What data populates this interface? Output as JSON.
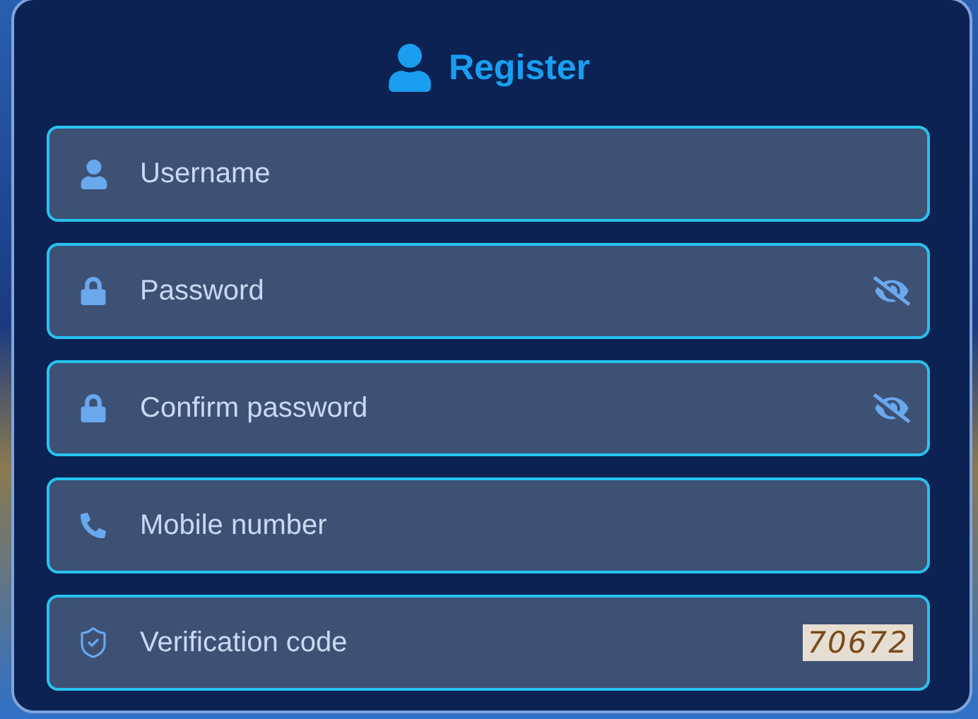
{
  "title": "Register",
  "fields": [
    {
      "kind": "text",
      "placeholder": "Username"
    },
    {
      "kind": "password",
      "placeholder": "Password"
    },
    {
      "kind": "password",
      "placeholder": "Confirm password"
    },
    {
      "kind": "phone",
      "placeholder": "Mobile number"
    },
    {
      "kind": "code",
      "placeholder": "Verification code",
      "captcha": "70672"
    }
  ]
}
